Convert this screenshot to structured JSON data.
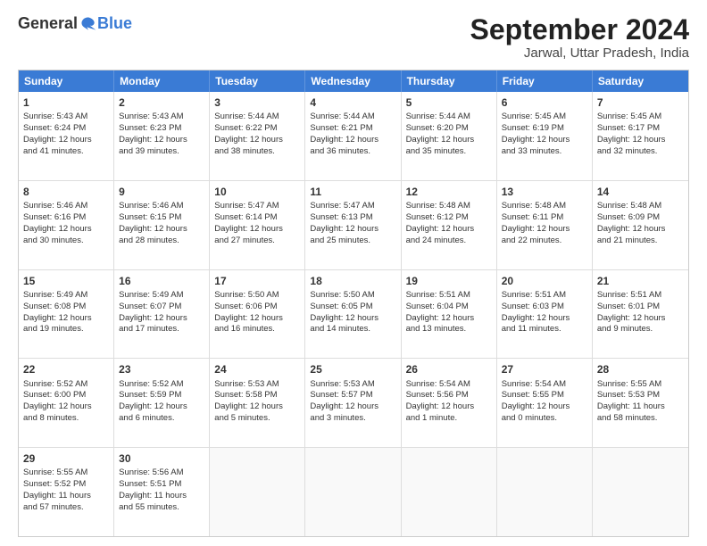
{
  "header": {
    "logo_general": "General",
    "logo_blue": "Blue",
    "month_title": "September 2024",
    "location": "Jarwal, Uttar Pradesh, India"
  },
  "days_of_week": [
    "Sunday",
    "Monday",
    "Tuesday",
    "Wednesday",
    "Thursday",
    "Friday",
    "Saturday"
  ],
  "rows": [
    [
      {
        "day": "",
        "empty": true
      },
      {
        "day": "",
        "empty": true
      },
      {
        "day": "",
        "empty": true
      },
      {
        "day": "",
        "empty": true
      },
      {
        "day": "",
        "empty": true
      },
      {
        "day": "",
        "empty": true
      },
      {
        "day": "",
        "empty": true
      }
    ],
    [
      {
        "day": "1",
        "lines": [
          "Sunrise: 5:43 AM",
          "Sunset: 6:24 PM",
          "Daylight: 12 hours",
          "and 41 minutes."
        ]
      },
      {
        "day": "2",
        "lines": [
          "Sunrise: 5:43 AM",
          "Sunset: 6:23 PM",
          "Daylight: 12 hours",
          "and 39 minutes."
        ]
      },
      {
        "day": "3",
        "lines": [
          "Sunrise: 5:44 AM",
          "Sunset: 6:22 PM",
          "Daylight: 12 hours",
          "and 38 minutes."
        ]
      },
      {
        "day": "4",
        "lines": [
          "Sunrise: 5:44 AM",
          "Sunset: 6:21 PM",
          "Daylight: 12 hours",
          "and 36 minutes."
        ]
      },
      {
        "day": "5",
        "lines": [
          "Sunrise: 5:44 AM",
          "Sunset: 6:20 PM",
          "Daylight: 12 hours",
          "and 35 minutes."
        ]
      },
      {
        "day": "6",
        "lines": [
          "Sunrise: 5:45 AM",
          "Sunset: 6:19 PM",
          "Daylight: 12 hours",
          "and 33 minutes."
        ]
      },
      {
        "day": "7",
        "lines": [
          "Sunrise: 5:45 AM",
          "Sunset: 6:17 PM",
          "Daylight: 12 hours",
          "and 32 minutes."
        ]
      }
    ],
    [
      {
        "day": "8",
        "lines": [
          "Sunrise: 5:46 AM",
          "Sunset: 6:16 PM",
          "Daylight: 12 hours",
          "and 30 minutes."
        ]
      },
      {
        "day": "9",
        "lines": [
          "Sunrise: 5:46 AM",
          "Sunset: 6:15 PM",
          "Daylight: 12 hours",
          "and 28 minutes."
        ]
      },
      {
        "day": "10",
        "lines": [
          "Sunrise: 5:47 AM",
          "Sunset: 6:14 PM",
          "Daylight: 12 hours",
          "and 27 minutes."
        ]
      },
      {
        "day": "11",
        "lines": [
          "Sunrise: 5:47 AM",
          "Sunset: 6:13 PM",
          "Daylight: 12 hours",
          "and 25 minutes."
        ]
      },
      {
        "day": "12",
        "lines": [
          "Sunrise: 5:48 AM",
          "Sunset: 6:12 PM",
          "Daylight: 12 hours",
          "and 24 minutes."
        ]
      },
      {
        "day": "13",
        "lines": [
          "Sunrise: 5:48 AM",
          "Sunset: 6:11 PM",
          "Daylight: 12 hours",
          "and 22 minutes."
        ]
      },
      {
        "day": "14",
        "lines": [
          "Sunrise: 5:48 AM",
          "Sunset: 6:09 PM",
          "Daylight: 12 hours",
          "and 21 minutes."
        ]
      }
    ],
    [
      {
        "day": "15",
        "lines": [
          "Sunrise: 5:49 AM",
          "Sunset: 6:08 PM",
          "Daylight: 12 hours",
          "and 19 minutes."
        ]
      },
      {
        "day": "16",
        "lines": [
          "Sunrise: 5:49 AM",
          "Sunset: 6:07 PM",
          "Daylight: 12 hours",
          "and 17 minutes."
        ]
      },
      {
        "day": "17",
        "lines": [
          "Sunrise: 5:50 AM",
          "Sunset: 6:06 PM",
          "Daylight: 12 hours",
          "and 16 minutes."
        ]
      },
      {
        "day": "18",
        "lines": [
          "Sunrise: 5:50 AM",
          "Sunset: 6:05 PM",
          "Daylight: 12 hours",
          "and 14 minutes."
        ]
      },
      {
        "day": "19",
        "lines": [
          "Sunrise: 5:51 AM",
          "Sunset: 6:04 PM",
          "Daylight: 12 hours",
          "and 13 minutes."
        ]
      },
      {
        "day": "20",
        "lines": [
          "Sunrise: 5:51 AM",
          "Sunset: 6:03 PM",
          "Daylight: 12 hours",
          "and 11 minutes."
        ]
      },
      {
        "day": "21",
        "lines": [
          "Sunrise: 5:51 AM",
          "Sunset: 6:01 PM",
          "Daylight: 12 hours",
          "and 9 minutes."
        ]
      }
    ],
    [
      {
        "day": "22",
        "lines": [
          "Sunrise: 5:52 AM",
          "Sunset: 6:00 PM",
          "Daylight: 12 hours",
          "and 8 minutes."
        ]
      },
      {
        "day": "23",
        "lines": [
          "Sunrise: 5:52 AM",
          "Sunset: 5:59 PM",
          "Daylight: 12 hours",
          "and 6 minutes."
        ]
      },
      {
        "day": "24",
        "lines": [
          "Sunrise: 5:53 AM",
          "Sunset: 5:58 PM",
          "Daylight: 12 hours",
          "and 5 minutes."
        ]
      },
      {
        "day": "25",
        "lines": [
          "Sunrise: 5:53 AM",
          "Sunset: 5:57 PM",
          "Daylight: 12 hours",
          "and 3 minutes."
        ]
      },
      {
        "day": "26",
        "lines": [
          "Sunrise: 5:54 AM",
          "Sunset: 5:56 PM",
          "Daylight: 12 hours",
          "and 1 minute."
        ]
      },
      {
        "day": "27",
        "lines": [
          "Sunrise: 5:54 AM",
          "Sunset: 5:55 PM",
          "Daylight: 12 hours",
          "and 0 minutes."
        ]
      },
      {
        "day": "28",
        "lines": [
          "Sunrise: 5:55 AM",
          "Sunset: 5:53 PM",
          "Daylight: 11 hours",
          "and 58 minutes."
        ]
      }
    ],
    [
      {
        "day": "29",
        "lines": [
          "Sunrise: 5:55 AM",
          "Sunset: 5:52 PM",
          "Daylight: 11 hours",
          "and 57 minutes."
        ]
      },
      {
        "day": "30",
        "lines": [
          "Sunrise: 5:56 AM",
          "Sunset: 5:51 PM",
          "Daylight: 11 hours",
          "and 55 minutes."
        ]
      },
      {
        "day": "",
        "empty": true
      },
      {
        "day": "",
        "empty": true
      },
      {
        "day": "",
        "empty": true
      },
      {
        "day": "",
        "empty": true
      },
      {
        "day": "",
        "empty": true
      }
    ]
  ]
}
